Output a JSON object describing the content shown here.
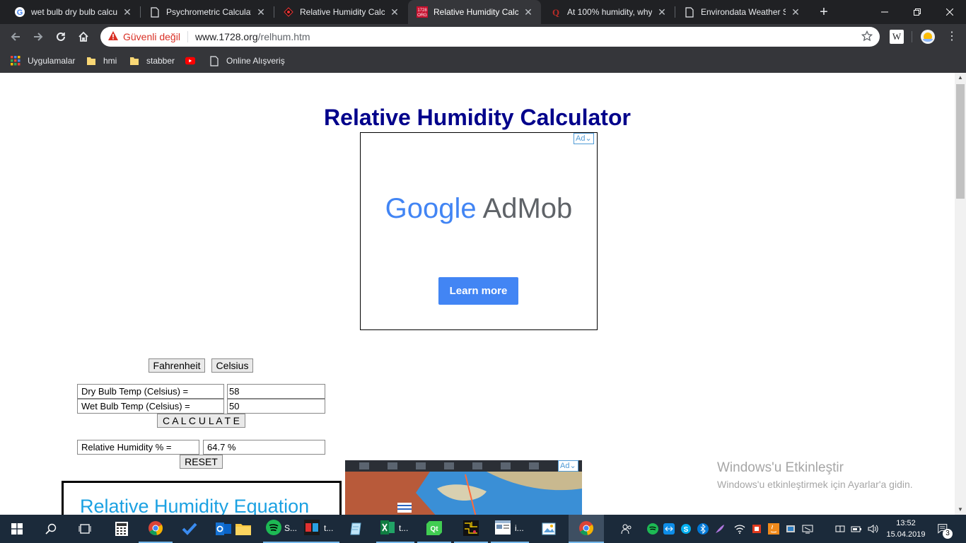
{
  "browser": {
    "tabs": [
      {
        "title": "wet bulb dry bulb calcu",
        "favicon": "google-icon"
      },
      {
        "title": "Psychrometric Calculato",
        "favicon": "page-icon"
      },
      {
        "title": "Relative Humidity Calcu",
        "favicon": "diamond-icon"
      },
      {
        "title": "Relative Humidity Calcu",
        "favicon": "1728-icon",
        "badge": "1728 ORG",
        "active": true
      },
      {
        "title": "At 100% humidity, why",
        "favicon": "quora-icon",
        "badge": "Q"
      },
      {
        "title": "Environdata Weather St",
        "favicon": "page-icon"
      }
    ],
    "security_label": "Güvenli değil",
    "url_host": "www.1728.org",
    "url_path": "/relhum.htm",
    "extension_label": "W",
    "bookmarks": [
      {
        "label": "Uygulamalar",
        "icon": "apps-grid-icon"
      },
      {
        "label": "hmi",
        "icon": "folder-icon"
      },
      {
        "label": "stabber",
        "icon": "folder-icon"
      },
      {
        "label": "",
        "icon": "youtube-icon"
      },
      {
        "label": "Online Alışveriş",
        "icon": "page-icon"
      }
    ]
  },
  "page": {
    "title": "Relative Humidity Calculator",
    "ad_badge": "Ad",
    "ad": {
      "logo_google": "Google",
      "logo_admob": "AdMob",
      "cta": "Learn more"
    },
    "unit_buttons": {
      "fahrenheit": "Fahrenheit",
      "celsius": "Celsius"
    },
    "form": {
      "dry_bulb_label": "Dry Bulb Temp (Celsius) =",
      "dry_bulb_value": "58",
      "wet_bulb_label": "Wet Bulb Temp (Celsius) =",
      "wet_bulb_value": "50",
      "calculate_label": "C A L C U L A T E",
      "rh_label": "Relative Humidity % =",
      "rh_value": "64.7 %",
      "reset_label": "RESET"
    },
    "equation_heading": "Relative Humidity Equation",
    "ad2_badge": "Ad"
  },
  "os": {
    "watermark_title": "Windows'u Etkinleştir",
    "watermark_subtitle": "Windows'u etkinleştirmek için Ayarlar'a gidin.",
    "taskbar_apps": [
      {
        "label": "S...",
        "icon": "spotify-icon"
      },
      {
        "label": "t...",
        "icon": "game-icon"
      },
      {
        "label": "",
        "icon": "notepad-icon"
      },
      {
        "label": "t...",
        "icon": "excel-icon"
      },
      {
        "label": "",
        "icon": "qt-icon"
      },
      {
        "label": "",
        "icon": "circuit-icon"
      },
      {
        "label": "i...",
        "icon": "window-icon"
      },
      {
        "label": "",
        "icon": "paint-icon"
      },
      {
        "label": "",
        "icon": "chrome-icon"
      }
    ],
    "clock_time": "13:52",
    "clock_date": "15.04.2019",
    "notification_count": "3"
  },
  "colors": {
    "title_blue": "#00008b",
    "chrome_dark": "#202124",
    "taskbar": "#1b2a3a",
    "equation_blue": "#1ba1e2",
    "admob_button": "#4285f4"
  }
}
